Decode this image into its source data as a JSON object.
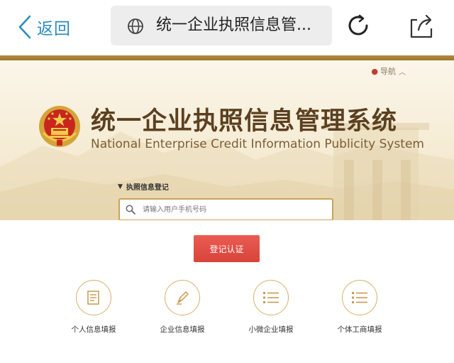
{
  "browser": {
    "back_label": "返回",
    "page_title": "统一企业执照信息管..."
  },
  "hero": {
    "nav_label": "导航",
    "title_cn": "统一企业执照信息管理系统",
    "title_en": "National Enterprise Credit Information Publicity System"
  },
  "form": {
    "section_label": "执照信息登记",
    "phone_placeholder": "请输入用户手机号码",
    "submit_label": "登记认证"
  },
  "features": [
    {
      "label": "个人信息填报",
      "icon": "document-icon"
    },
    {
      "label": "企业信息填报",
      "icon": "pen-icon"
    },
    {
      "label": "小微企业填报",
      "icon": "list-icon"
    },
    {
      "label": "个体工商填报",
      "icon": "list-icon"
    }
  ],
  "colors": {
    "accent_blue": "#2a8bc0",
    "gold": "#c9a35a",
    "button_red": "#e14d44",
    "title_brown": "#5b4020"
  }
}
